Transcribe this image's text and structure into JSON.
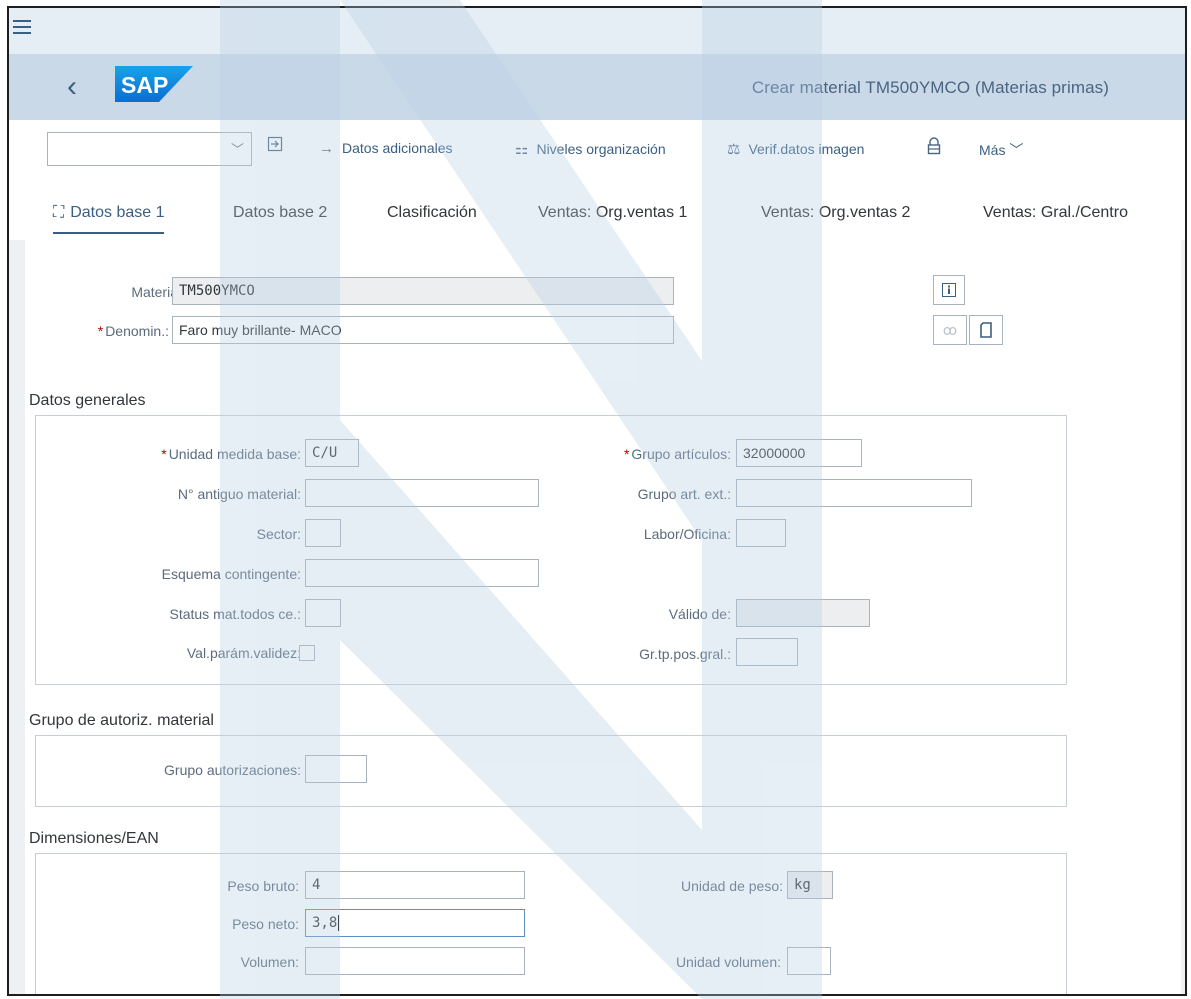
{
  "shell": {
    "title": "Crear material TM500YMCO (Materias primas)",
    "logo_text": "SAP"
  },
  "toolbar": {
    "command_value": "",
    "items": [
      {
        "label": "Datos adicionales",
        "icon": "arrow-right-icon"
      },
      {
        "label": "Niveles organización",
        "icon": "org-levels-icon"
      },
      {
        "label": "Verif.datos imagen",
        "icon": "balance-check-icon"
      },
      {
        "label": "Más",
        "icon": "chevron-down-icon"
      }
    ]
  },
  "tabs": [
    {
      "label": "Datos base 1",
      "active": true
    },
    {
      "label": "Datos base 2"
    },
    {
      "label": "Clasificación"
    },
    {
      "label": "Ventas: Org.ventas 1"
    },
    {
      "label": "Ventas: Org.ventas 2"
    },
    {
      "label": "Ventas: Gral./Centro"
    }
  ],
  "header_fields": {
    "material_label": "Material:",
    "material_value": "TM500YMCO",
    "denomin_label": "Denomin.:",
    "denomin_value": "Faro muy brillante- MACO"
  },
  "datos_generales": {
    "title": "Datos generales",
    "unidad_medida_base_label": "Unidad medida base:",
    "unidad_medida_base_value": "C/U",
    "grupo_articulos_label": "Grupo artículos:",
    "grupo_articulos_value": "32000000",
    "no_antiguo_label": "N° antiguo material:",
    "no_antiguo_value": "",
    "grupo_art_ext_label": "Grupo art. ext.:",
    "grupo_art_ext_value": "",
    "sector_label": "Sector:",
    "sector_value": "",
    "labor_oficina_label": "Labor/Oficina:",
    "labor_oficina_value": "",
    "esquema_contingente_label": "Esquema contingente:",
    "esquema_contingente_value": "",
    "status_mat_label": "Status mat.todos ce.:",
    "status_mat_value": "",
    "valido_de_label": "Válido de:",
    "valido_de_value": "",
    "val_param_label": "Val.parám.validez:",
    "gr_tp_pos_label": "Gr.tp.pos.gral.:",
    "gr_tp_pos_value": ""
  },
  "grupo_autoriz": {
    "title": "Grupo de autoriz. material",
    "grupo_autorizaciones_label": "Grupo autorizaciones:",
    "grupo_autorizaciones_value": ""
  },
  "dimensiones": {
    "title": "Dimensiones/EAN",
    "peso_bruto_label": "Peso bruto:",
    "peso_bruto_value": "4",
    "unidad_peso_label": "Unidad de peso:",
    "unidad_peso_value": "kg",
    "peso_neto_label": "Peso neto:",
    "peso_neto_value": "3,8",
    "volumen_label": "Volumen:",
    "volumen_value": "",
    "unidad_volumen_label": "Unidad volumen:",
    "unidad_volumen_value": ""
  },
  "colors": {
    "shell_bg": "#cad9e8",
    "accent": "#3b5f82",
    "required": "#bb0000",
    "watermark": "#b5cde3"
  }
}
